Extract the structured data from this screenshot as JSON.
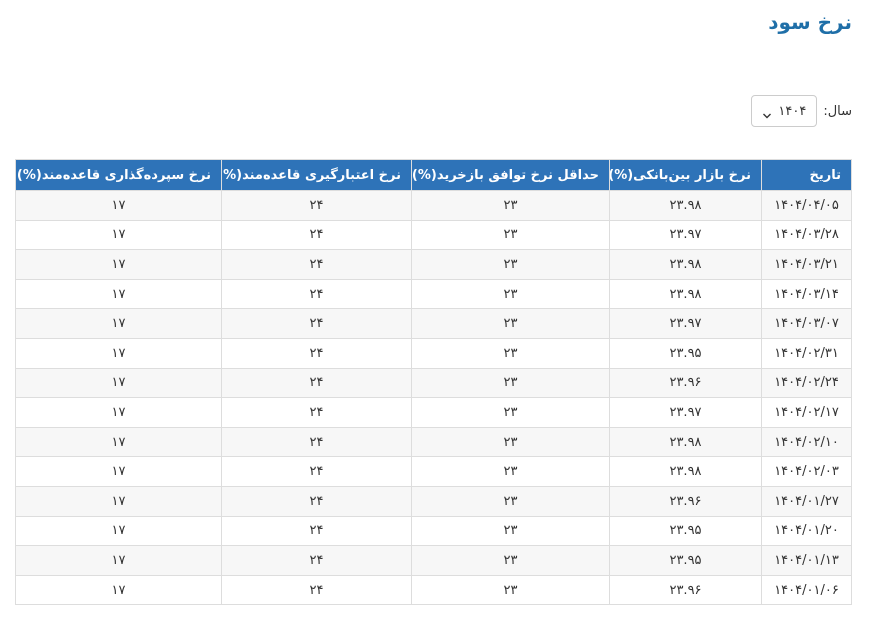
{
  "page": {
    "title": "نرخ سود"
  },
  "filter": {
    "year_label": "سال:",
    "year_value": "۱۴۰۴"
  },
  "table": {
    "headers": [
      "تاریخ",
      "نرخ بازار بین‌بانکی(%)",
      "حداقل نرخ توافق بازخرید(%)",
      "نرخ اعتبارگیری قاعده‌مند(%)",
      "نرخ سپرده‌گذاری قاعده‌مند(%)"
    ],
    "rows": [
      [
        "۱۴۰۴/۰۴/۰۵",
        "۲۳.۹۸",
        "۲۳",
        "۲۴",
        "۱۷"
      ],
      [
        "۱۴۰۴/۰۳/۲۸",
        "۲۳.۹۷",
        "۲۳",
        "۲۴",
        "۱۷"
      ],
      [
        "۱۴۰۴/۰۳/۲۱",
        "۲۳.۹۸",
        "۲۳",
        "۲۴",
        "۱۷"
      ],
      [
        "۱۴۰۴/۰۳/۱۴",
        "۲۳.۹۸",
        "۲۳",
        "۲۴",
        "۱۷"
      ],
      [
        "۱۴۰۴/۰۳/۰۷",
        "۲۳.۹۷",
        "۲۳",
        "۲۴",
        "۱۷"
      ],
      [
        "۱۴۰۴/۰۲/۳۱",
        "۲۳.۹۵",
        "۲۳",
        "۲۴",
        "۱۷"
      ],
      [
        "۱۴۰۴/۰۲/۲۴",
        "۲۳.۹۶",
        "۲۳",
        "۲۴",
        "۱۷"
      ],
      [
        "۱۴۰۴/۰۲/۱۷",
        "۲۳.۹۷",
        "۲۳",
        "۲۴",
        "۱۷"
      ],
      [
        "۱۴۰۴/۰۲/۱۰",
        "۲۳.۹۸",
        "۲۳",
        "۲۴",
        "۱۷"
      ],
      [
        "۱۴۰۴/۰۲/۰۳",
        "۲۳.۹۸",
        "۲۳",
        "۲۴",
        "۱۷"
      ],
      [
        "۱۴۰۴/۰۱/۲۷",
        "۲۳.۹۶",
        "۲۳",
        "۲۴",
        "۱۷"
      ],
      [
        "۱۴۰۴/۰۱/۲۰",
        "۲۳.۹۵",
        "۲۳",
        "۲۴",
        "۱۷"
      ],
      [
        "۱۴۰۴/۰۱/۱۳",
        "۲۳.۹۵",
        "۲۳",
        "۲۴",
        "۱۷"
      ],
      [
        "۱۴۰۴/۰۱/۰۶",
        "۲۳.۹۶",
        "۲۳",
        "۲۴",
        "۱۷"
      ]
    ]
  },
  "colors": {
    "title": "#1f6fa8",
    "header_bg": "#2e73b8",
    "stripe": "#f7f7f7"
  }
}
